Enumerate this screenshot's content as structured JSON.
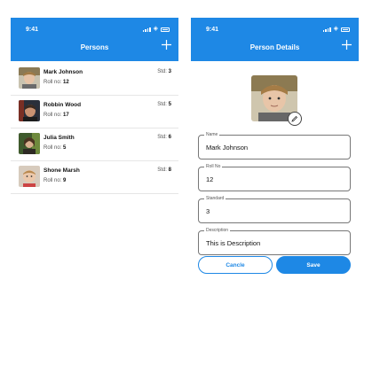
{
  "status_bar": {
    "time": "9:41"
  },
  "list_screen": {
    "title": "Persons",
    "add_icon": "plus-icon",
    "std_label": "Std:",
    "roll_label": "Roll no:",
    "persons": [
      {
        "name": "Mark Johnson",
        "roll": "12",
        "std": "3"
      },
      {
        "name": "Robbin Wood",
        "roll": "17",
        "std": "5"
      },
      {
        "name": "Julia Smith",
        "roll": "5",
        "std": "6"
      },
      {
        "name": "Shone Marsh",
        "roll": "9",
        "std": "8"
      }
    ]
  },
  "details_screen": {
    "title": "Person Details",
    "add_icon": "plus-icon",
    "edit_icon": "pencil-icon",
    "fields": [
      {
        "label": "Name",
        "value": "Mark Johnson"
      },
      {
        "label": "Roll No",
        "value": "12"
      },
      {
        "label": "Standard",
        "value": "3"
      },
      {
        "label": "Description",
        "value": "This is Description"
      }
    ],
    "cancel_label": "Cancle",
    "save_label": "Save"
  },
  "colors": {
    "primary": "#1e88e5",
    "divider": "#e6e6e6",
    "field_border": "#777777"
  }
}
